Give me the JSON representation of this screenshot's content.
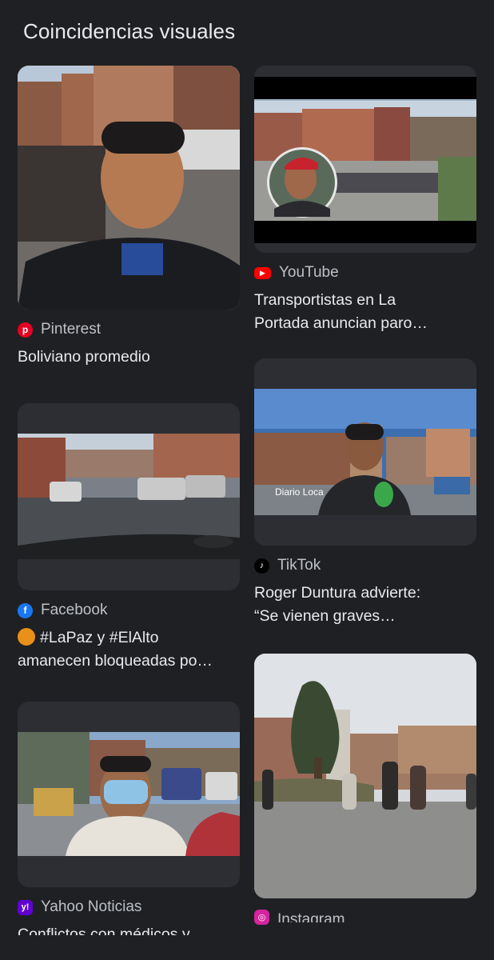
{
  "section": {
    "title": "Coincidencias visuales"
  },
  "results": [
    {
      "source": "Pinterest",
      "caption": "Boliviano promedio"
    },
    {
      "source": "YouTube",
      "caption_line1": "Transportistas en La",
      "caption_line2": "Portada anuncian paro…"
    },
    {
      "source": "Facebook",
      "caption_line1": "#LaPaz y #ElAlto",
      "caption_line2": "amanecen bloqueadas po…"
    },
    {
      "source": "TikTok",
      "caption_line1": "Roger Duntura advierte:",
      "caption_line2": "“Se vienen graves…",
      "overlay_text": "Diario Loca"
    },
    {
      "source": "Yahoo Noticias",
      "caption": "Conflictos con médicos y"
    },
    {
      "source": "Instagram"
    }
  ],
  "colors": {
    "background": "#1f2023",
    "card": "#2d2e33",
    "pinterest": "#e60023",
    "youtube": "#ff0000",
    "facebook": "#1877f2",
    "yahoo": "#6001d2"
  }
}
